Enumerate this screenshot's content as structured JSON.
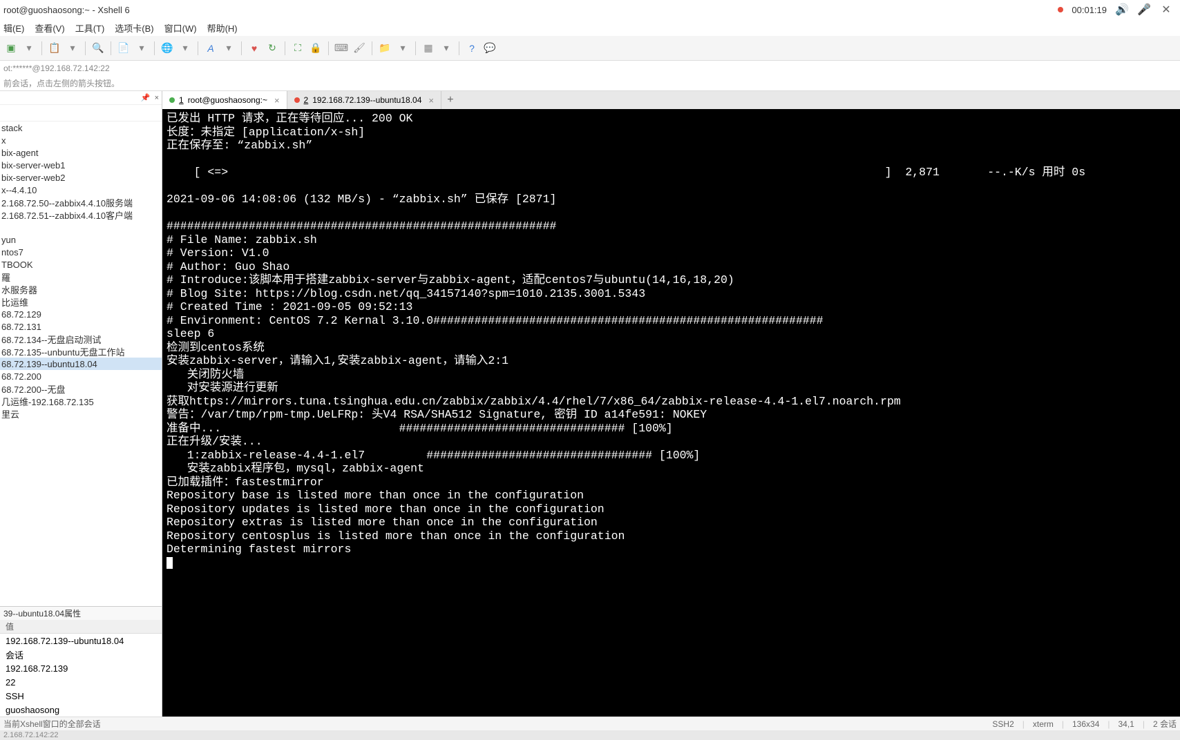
{
  "title": "root@guoshaosong:~ - Xshell 6",
  "timer": "00:01:19",
  "menu": {
    "edit": "辑(E)",
    "view": "查看(V)",
    "tools": "工具(T)",
    "tabs": "选项卡(B)",
    "window": "窗口(W)",
    "help": "帮助(H)"
  },
  "addr": "ot:******@192.168.72.142:22",
  "info": "前会话，点击左侧的箭头按钮。",
  "sidebar": {
    "pin": "📌",
    "close": "×",
    "items": [
      "stack",
      "x",
      "bix-agent",
      "bix-server-web1",
      "bix-server-web2",
      "x--4.4.10",
      "2.168.72.50--zabbix4.4.10服务端",
      "2.168.72.51--zabbix4.4.10客户端",
      "",
      "yun",
      "ntos7",
      "TBOOK",
      "羅",
      "水服务器",
      "比运维",
      "68.72.129",
      "68.72.131",
      "68.72.134--无盘启动测试",
      "68.72.135--unbuntu无盘工作站",
      "68.72.139--ubuntu18.04",
      "68.72.200",
      "68.72.200--无盘",
      "几运维-192.168.72.135",
      "里云"
    ],
    "selected_index": 19,
    "props_title": "39--ubuntu18.04属性",
    "props_header": "值",
    "props": [
      "192.168.72.139--ubuntu18.04",
      "会话",
      "192.168.72.139",
      "22",
      "SSH",
      "guoshaosong"
    ]
  },
  "tabs": [
    {
      "num": "1",
      "label": "root@guoshaosong:~",
      "dot": "green",
      "active": true
    },
    {
      "num": "2",
      "label": "192.168.72.139--ubuntu18.04",
      "dot": "red",
      "active": false
    }
  ],
  "terminal_lines": [
    "已发出 HTTP 请求，正在等待回应... 200 OK",
    "长度：未指定 [application/x-sh]",
    "正在保存至: “zabbix.sh”",
    "",
    "    [ <=>                                                                                                ]  2,871       --.-K/s 用时 0s",
    "",
    "2021-09-06 14:08:06 (132 MB/s) - “zabbix.sh” 已保存 [2871]",
    "",
    "#########################################################",
    "# File Name: zabbix.sh",
    "# Version: V1.0",
    "# Author: Guo Shao",
    "# Introduce:该脚本用于搭建zabbix-server与zabbix-agent，适配centos7与ubuntu(14,16,18,20)",
    "# Blog Site: https://blog.csdn.net/qq_34157140?spm=1010.2135.3001.5343",
    "# Created Time : 2021-09-05 09:52:13",
    "# Environment: CentOS 7.2 Kernal 3.10.0#########################################################",
    "sleep 6",
    "检测到centos系统",
    "安装zabbix-server，请输入1,安装zabbix-agent，请输入2:1",
    "   关闭防火墙",
    "   对安装源进行更新",
    "获取https://mirrors.tuna.tsinghua.edu.cn/zabbix/zabbix/4.4/rhel/7/x86_64/zabbix-release-4.4-1.el7.noarch.rpm",
    "警告：/var/tmp/rpm-tmp.UeLFRp: 头V4 RSA/SHA512 Signature, 密钥 ID a14fe591: NOKEY",
    "准备中...                          ################################# [100%]",
    "正在升级/安装...",
    "   1:zabbix-release-4.4-1.el7         ################################# [100%]",
    "   安装zabbix程序包，mysql，zabbix-agent",
    "已加载插件：fastestmirror",
    "Repository base is listed more than once in the configuration",
    "Repository updates is listed more than once in the configuration",
    "Repository extras is listed more than once in the configuration",
    "Repository centosplus is listed more than once in the configuration",
    "Determining fastest mirrors"
  ],
  "statusbar": {
    "left": "当前Xshell窗口的全部会话",
    "ssh": "SSH2",
    "term": "xterm",
    "size": "136x34",
    "pos": "34,1",
    "sessions": "2 会话"
  },
  "bottombar": "2.168.72.142:22"
}
